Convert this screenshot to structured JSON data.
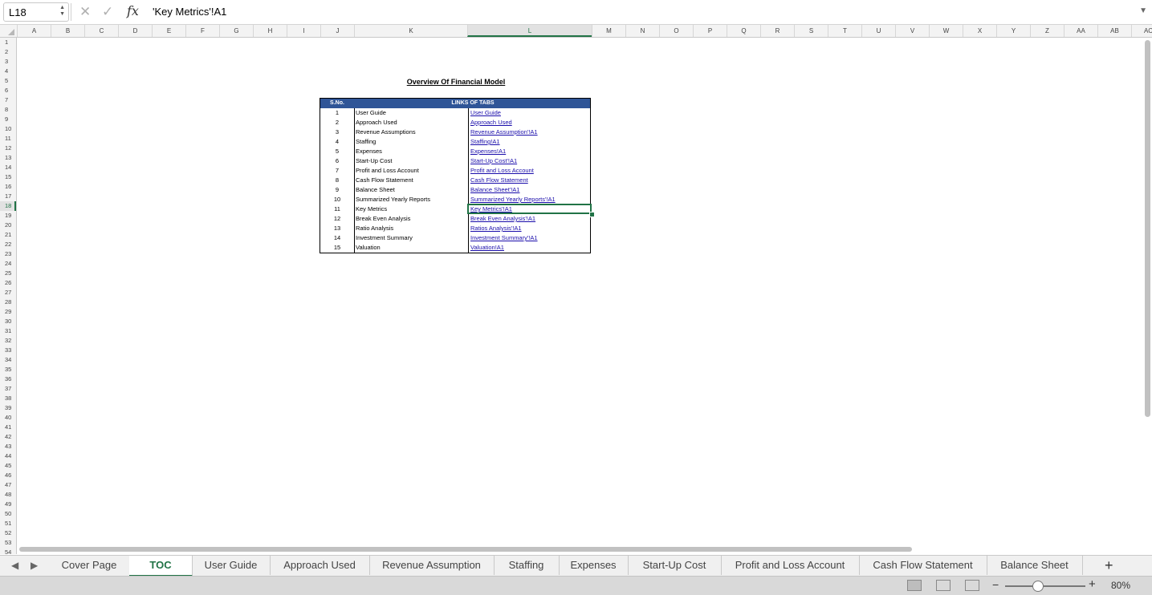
{
  "formula_bar": {
    "name_box": "L18",
    "cancel_icon": "cancel-icon",
    "confirm_icon": "check-icon",
    "fx_label": "fx",
    "content": "'Key Metrics'!A1"
  },
  "columns": [
    "A",
    "B",
    "C",
    "D",
    "E",
    "F",
    "G",
    "H",
    "I",
    "J",
    "K",
    "L",
    "M",
    "N",
    "O",
    "P",
    "Q",
    "R",
    "S",
    "T",
    "U",
    "V",
    "W",
    "X",
    "Y",
    "Z",
    "AA",
    "AB",
    "AC"
  ],
  "selected_column": "L",
  "rows": [
    "1",
    "2",
    "3",
    "4",
    "5",
    "6",
    "7",
    "8",
    "9",
    "10",
    "11",
    "12",
    "13",
    "14",
    "15",
    "16",
    "17",
    "18",
    "19",
    "20",
    "21",
    "22",
    "23",
    "24",
    "25",
    "26",
    "27",
    "28",
    "29",
    "30",
    "31",
    "32",
    "33",
    "34",
    "35",
    "36",
    "37",
    "38",
    "39",
    "40",
    "41",
    "42",
    "43",
    "44",
    "45",
    "46",
    "47",
    "48",
    "49",
    "50",
    "51",
    "52",
    "53",
    "54"
  ],
  "selected_row": "18",
  "sheet": {
    "title": "Overview Of Financial Model",
    "header_sno": "S.No.",
    "header_links": "LINKS OF TABS",
    "header_color": "#2f5597",
    "rows": [
      {
        "n": "1",
        "name": "User Guide",
        "link": "User Guide"
      },
      {
        "n": "2",
        "name": "Approach Used",
        "link": "Approach Used"
      },
      {
        "n": "3",
        "name": "Revenue Assumptions",
        "link": "Revenue Assumption'!A1"
      },
      {
        "n": "4",
        "name": "Staffing",
        "link": "Staffing!A1"
      },
      {
        "n": "5",
        "name": "Expenses",
        "link": "Expenses!A1"
      },
      {
        "n": "6",
        "name": "Start-Up Cost",
        "link": "Start-Up Cost'!A1"
      },
      {
        "n": "7",
        "name": "Profit and Loss Account",
        "link": "Profit and Loss Account"
      },
      {
        "n": "8",
        "name": "Cash Flow Statement",
        "link": "Cash Flow Statement"
      },
      {
        "n": "9",
        "name": "Balance Sheet",
        "link": "Balance Sheet'!A1"
      },
      {
        "n": "10",
        "name": "Summarized Yearly Reports",
        "link": "Summarized Yearly Reports'!A1"
      },
      {
        "n": "11",
        "name": "Key Metrics",
        "link": "Key Metrics'!A1"
      },
      {
        "n": "12",
        "name": "Break Even Analysis",
        "link": "Break Even Analysis'!A1"
      },
      {
        "n": "13",
        "name": "Ratio Analysis",
        "link": "Ratios Analysis'!A1"
      },
      {
        "n": "14",
        "name": "Investment Summary",
        "link": "Investment Summary'!A1"
      },
      {
        "n": "15",
        "name": "Valuation",
        "link": "Valuation!A1"
      }
    ]
  },
  "tabs": {
    "prev_icon": "chevron-left-icon",
    "next_icon": "chevron-right-icon",
    "items": [
      {
        "label": "Cover Page"
      },
      {
        "label": "TOC",
        "active": true
      },
      {
        "label": "User Guide"
      },
      {
        "label": "Approach Used"
      },
      {
        "label": "Revenue Assumption"
      },
      {
        "label": "Staffing"
      },
      {
        "label": "Expenses"
      },
      {
        "label": "Start-Up Cost"
      },
      {
        "label": "Profit and Loss Account"
      },
      {
        "label": "Cash Flow Statement"
      },
      {
        "label": "Balance Sheet"
      }
    ],
    "add_label": "+"
  },
  "status": {
    "zoom": "80%",
    "zoom_minus": "−",
    "zoom_plus": "+"
  },
  "colors": {
    "accent": "#217346",
    "link": "#1a0dab"
  }
}
